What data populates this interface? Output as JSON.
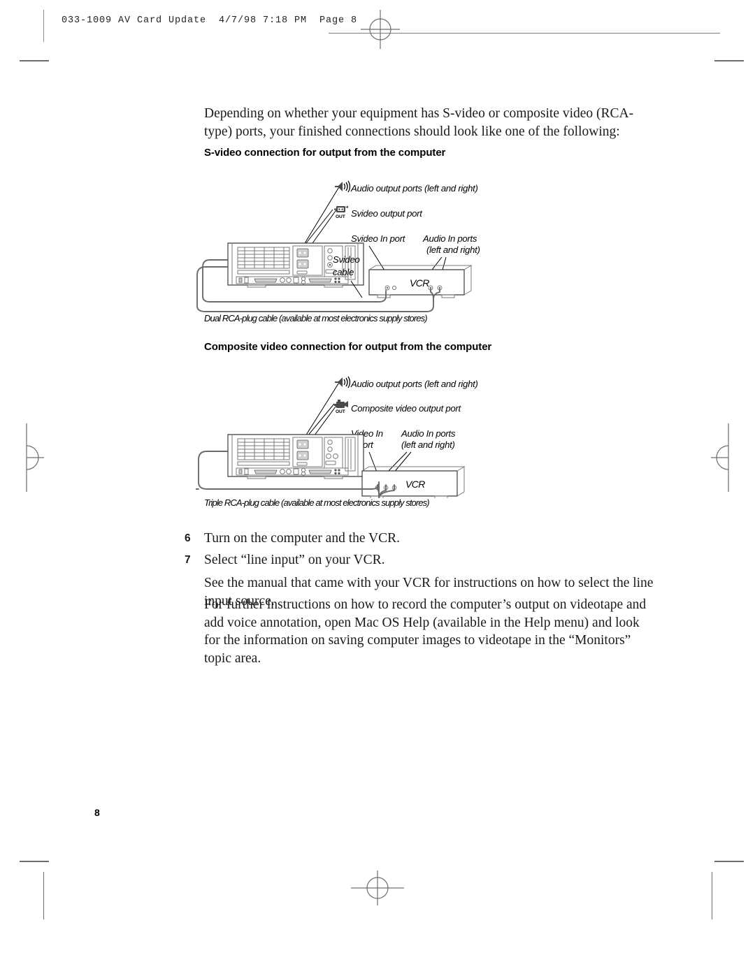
{
  "document": {
    "header_slug": "033-1009 AV Card Update  4/7/98 7:18 PM  Page 8",
    "page_number": "8"
  },
  "intro": {
    "paragraph": "Depending on whether your equipment has S-video or composite video (RCA-type) ports, your finished connections should look like one of the following:"
  },
  "figures": [
    {
      "heading": "S-video connection for output from the computer",
      "computer_labels": [
        {
          "icon": "speaker-icon",
          "text": "Audio output ports (left and right)"
        },
        {
          "icon": "svideo-out-icon",
          "icon_sublabel": "OUT",
          "text": "Svideo output port"
        }
      ],
      "vcr_labels": [
        "Svideo In port",
        "Audio In ports",
        "(left and right)"
      ],
      "cable_labels": [
        "Svideo",
        "cable"
      ],
      "device_label": "VCR",
      "caption": "Dual RCA-plug cable (available at most electronics supply stores)"
    },
    {
      "heading": "Composite video connection for output from the computer",
      "computer_labels": [
        {
          "icon": "speaker-icon",
          "text": "Audio output ports (left and right)"
        },
        {
          "icon": "composite-video-out-icon",
          "icon_sublabel": "OUT",
          "text": "Composite video output port"
        }
      ],
      "vcr_labels": [
        "Video In",
        "port",
        "Audio In ports",
        "(left and right)"
      ],
      "cable_labels": [],
      "device_label": "VCR",
      "caption": "Triple RCA-plug cable (available at most electronics supply stores)"
    }
  ],
  "steps": [
    {
      "num": "6",
      "text": "Turn on the computer and the VCR."
    },
    {
      "num": "7",
      "text": "Select “line input” on your VCR."
    }
  ],
  "step_note": "See the manual that came with your VCR for instructions on how to select the line input source.",
  "closing_paragraph": "For further instructions on how to record the computer’s output on videotape and add voice annotation, open Mac OS Help (available in the Help menu) and look for the information on saving computer images to videotape in the “Monitors” topic area."
}
